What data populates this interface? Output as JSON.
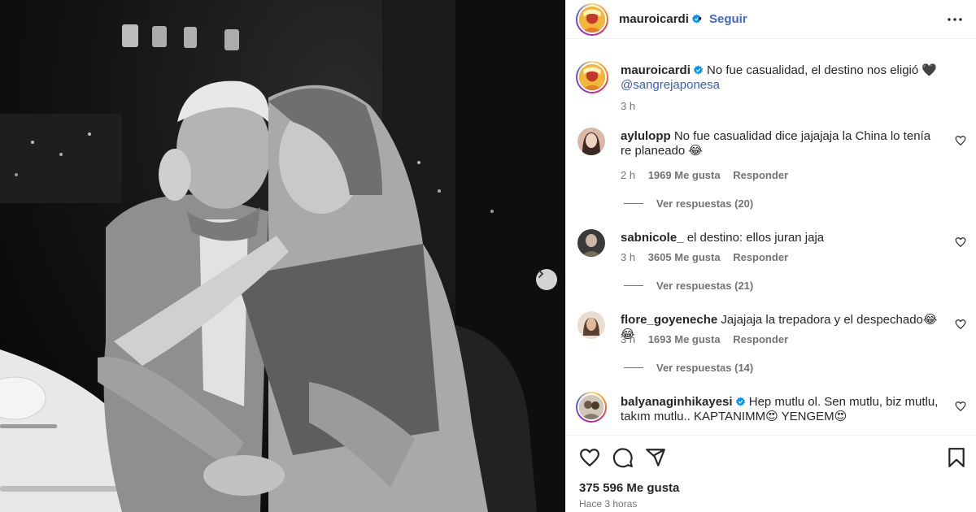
{
  "post": {
    "author": "mauroicardi",
    "follow_label": "Seguir",
    "separator": "•",
    "caption_text": "No fue casualidad, el destino nos eligió 🖤",
    "caption_mention": "@sangrejaponesa",
    "caption_time": "3 h",
    "likes": "375 596 Me gusta",
    "posted_ago": "Hace 3 horas"
  },
  "comments": [
    {
      "user": "aylulopp",
      "text": "No fue casualidad dice jajajaja la China lo tenía re planeado 😂",
      "time": "2 h",
      "likes": "1969 Me gusta",
      "reply_label": "Responder",
      "view_replies": "Ver respuestas (20)"
    },
    {
      "user": "sabnicole_",
      "text": "el destino: ellos juran jaja",
      "time": "3 h",
      "likes": "3605 Me gusta",
      "reply_label": "Responder",
      "view_replies": "Ver respuestas (21)"
    },
    {
      "user": "flore_goyeneche",
      "text": "Jajajaja la trepadora y el despechado😂😂",
      "time": "3 h",
      "likes": "1693 Me gusta",
      "reply_label": "Responder",
      "view_replies": "Ver respuestas (14)"
    },
    {
      "user": "balyanaginhikayesi",
      "text": "Hep mutlu ol. Sen mutlu, biz mutlu, takım mutlu.. KAPTANIMM😍 YENGEM😍"
    }
  ],
  "colors": {
    "link_blue": "#4367ce",
    "verified_blue": "#0095f6",
    "text_secondary": "#737373",
    "divider": "#efefef"
  },
  "icons": [
    "more-options-icon",
    "verified-badge-icon",
    "heart-icon",
    "comment-icon",
    "share-icon",
    "bookmark-icon",
    "chevron-right-icon"
  ]
}
